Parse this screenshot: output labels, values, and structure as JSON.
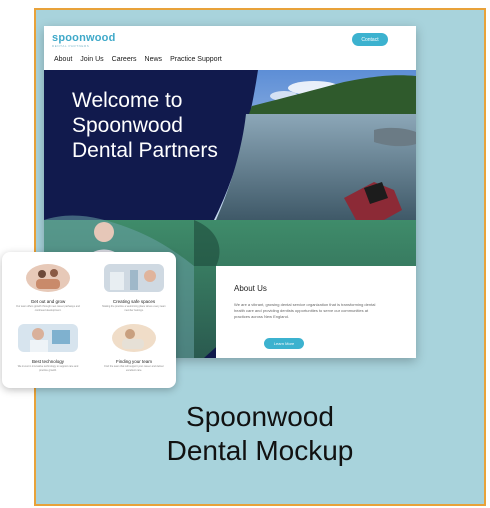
{
  "site": {
    "logo": "spoonwood",
    "logo_tagline": "DENTAL PARTNERS",
    "contact_label": "Contact",
    "menu": [
      "About",
      "Join Us",
      "Careers",
      "News",
      "Practice Support"
    ]
  },
  "hero": {
    "title": "Welcome to Spoonwood Dental Partners"
  },
  "about": {
    "title": "About Us",
    "text": "We are a vibrant, growing dental service organization that is transforming dental health care and providing dentists opportunities to serve our communities at practices across New England.",
    "button_label": "Learn More"
  },
  "card": {
    "tiles": [
      {
        "label": "Get out and grow",
        "text": "Our team offers growth through new career pathways and continued development."
      },
      {
        "label": "Creating safe spaces",
        "text": "Making the practice a welcoming place where every team member belongs."
      },
      {
        "label": "Best technology",
        "text": "We invest in innovative technology to support care and practice growth."
      },
      {
        "label": "Finding your team",
        "text": "Find the team that will support your career and deliver excellent care."
      }
    ]
  },
  "caption": {
    "line1": "Spoonwood",
    "line2": "Dental Mockup"
  },
  "colors": {
    "frame_bg": "#a8d3dc",
    "frame_border": "#e8a23a",
    "navy": "#111a4d",
    "accent": "#3cb2cf"
  }
}
